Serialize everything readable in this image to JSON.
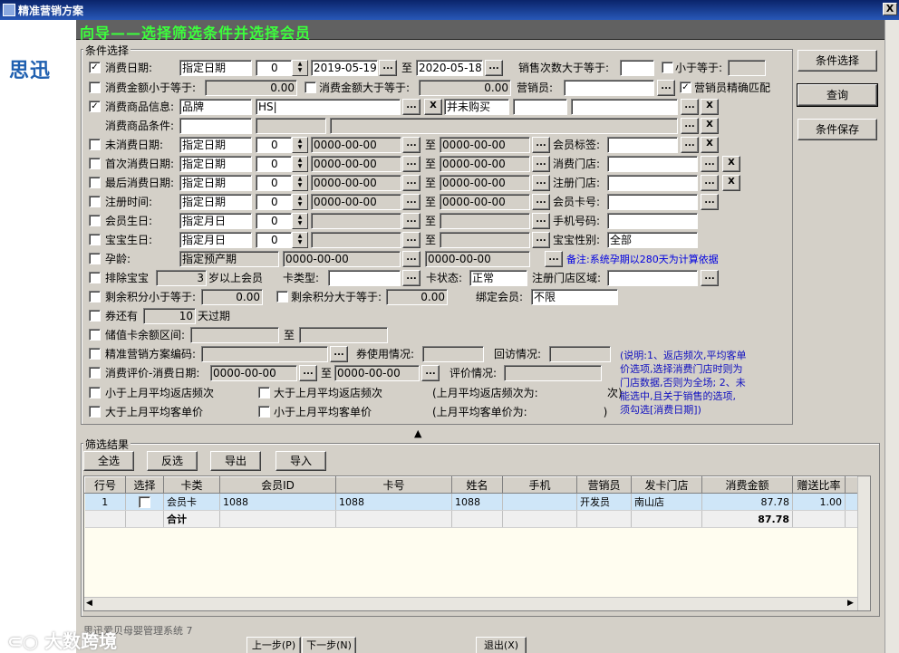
{
  "window": {
    "title": "精准营销方案",
    "close": "X"
  },
  "brand": {
    "logo": "思迅"
  },
  "banner": "向导——选择筛选条件并选择会员",
  "cond": {
    "group": "条件选择",
    "consume_date": {
      "label": "消费日期:",
      "mode": "指定日期",
      "n": "0",
      "from": "2019-05-19",
      "to_label": "至",
      "to": "2020-05-18"
    },
    "sales_count": {
      "label": "销售次数大于等于:",
      "value": "",
      "lt_label": "小于等于:",
      "lt_value": ""
    },
    "amt_lt": {
      "label": "消费金额小于等于:",
      "value": "0.00"
    },
    "amt_gt": {
      "label": "消费金额大于等于:",
      "value": "0.00"
    },
    "salesperson": {
      "label": "营销员:",
      "value": "",
      "exact_label": "营销员精确匹配"
    },
    "goods_info": {
      "label": "消费商品信息:",
      "type": "品牌",
      "value": "HS|",
      "exclude": "并未购买"
    },
    "goods_cond": {
      "label": "消费商品条件:"
    },
    "not_consume": {
      "label": "未消费日期:",
      "mode": "指定日期",
      "n": "0",
      "from": "0000-00-00",
      "to_label": "至",
      "to": "0000-00-00"
    },
    "member_tag": {
      "label": "会员标签:"
    },
    "first_consume": {
      "label": "首次消费日期:",
      "mode": "指定日期",
      "n": "0",
      "from": "0000-00-00",
      "to_label": "至",
      "to": "0000-00-00"
    },
    "consume_store": {
      "label": "消费门店:"
    },
    "last_consume": {
      "label": "最后消费日期:",
      "mode": "指定日期",
      "n": "0",
      "from": "0000-00-00",
      "to_label": "至",
      "to": "0000-00-00"
    },
    "reg_store": {
      "label": "注册门店:"
    },
    "reg_time": {
      "label": "注册时间:",
      "mode": "指定日期",
      "n": "0",
      "from": "0000-00-00",
      "to_label": "至",
      "to": "0000-00-00"
    },
    "card_no": {
      "label": "会员卡号:"
    },
    "member_bday": {
      "label": "会员生日:",
      "mode": "指定月日",
      "n": "0",
      "to_label": "至"
    },
    "phone": {
      "label": "手机号码:"
    },
    "baby_bday": {
      "label": "宝宝生日:",
      "mode": "指定月日",
      "n": "0",
      "to_label": "至"
    },
    "baby_gender": {
      "label": "宝宝性别:",
      "value": "全部"
    },
    "pregnancy": {
      "label": "孕龄:",
      "mode": "指定预产期",
      "from": "0000-00-00",
      "to": "0000-00-00",
      "note": "备注:系统孕期以280天为计算依据"
    },
    "exclude_baby": {
      "label": "排除宝宝",
      "age": "3",
      "suffix": "岁以上会员"
    },
    "card_type": {
      "label": "卡类型:"
    },
    "card_status": {
      "label": "卡状态:",
      "value": "正常"
    },
    "reg_region": {
      "label": "注册门店区域:"
    },
    "points_lt": {
      "label": "剩余积分小于等于:",
      "value": "0.00"
    },
    "points_gt": {
      "label": "剩余积分大于等于:",
      "value": "0.00"
    },
    "bind_member": {
      "label": "绑定会员:",
      "value": "不限"
    },
    "coupon": {
      "label": "券还有",
      "days": "10",
      "suffix": "天过期"
    },
    "stored_value": {
      "label": "储值卡余额区间:",
      "to_label": "至"
    },
    "plan_code": {
      "label": "精准营销方案编码:"
    },
    "coupon_use": {
      "label": "券使用情况:"
    },
    "revisit": {
      "label": "回访情况:"
    },
    "review": {
      "label": "消费评价-消费日期:",
      "from": "0000-00-00",
      "to_label": "至",
      "to": "0000-00-00",
      "status_label": "评价情况:"
    },
    "freq_lt": {
      "label": "小于上月平均返店频次"
    },
    "freq_gt": {
      "label": "大于上月平均返店频次"
    },
    "freq_info": "(上月平均返店频次为:                    次)",
    "price_gt": {
      "label": "大于上月平均客单价"
    },
    "price_lt": {
      "label": "小于上月平均客单价"
    },
    "price_info": "(上月平均客单价为:                      )",
    "explain": [
      "(说明:1、返店频次,平均客单",
      "价选项,选择消费门店时则为",
      "门店数据,否则为全场; 2、未",
      "能选中,且关于销售的选项,",
      "须勾选[消费日期])"
    ]
  },
  "side_buttons": {
    "cond_select": "条件选择",
    "query": "查询",
    "cond_save": "条件保存"
  },
  "results": {
    "group": "筛选结果",
    "buttons": {
      "select_all": "全选",
      "invert": "反选",
      "export": "导出",
      "import": "导入"
    },
    "columns": [
      "行号",
      "选择",
      "卡类",
      "会员ID",
      "卡号",
      "姓名",
      "手机",
      "营销员",
      "发卡门店",
      "消费金额",
      "赠送比率"
    ],
    "rows": [
      {
        "no": "1",
        "type": "会员卡",
        "id": "1088",
        "card": "1088",
        "name": "1088",
        "phone": "",
        "sales": "开发员",
        "store": "南山店",
        "amount": "87.78",
        "ratio": "1.00"
      }
    ],
    "total_label": "合计",
    "total_amount": "87.78"
  },
  "footer": {
    "app": "思迅爱贝母婴管理系统 7",
    "prev": "上一步(P)",
    "next": "下一步(N)",
    "exit": "退出(X)"
  },
  "watermark": "大数跨境",
  "colors": {
    "banner_bg": "#616161",
    "banner_text": "#3cff3c",
    "title_bar": "#0a246a",
    "selected_row": "#cfe6f8",
    "grid_bg": "#fffdf0"
  }
}
